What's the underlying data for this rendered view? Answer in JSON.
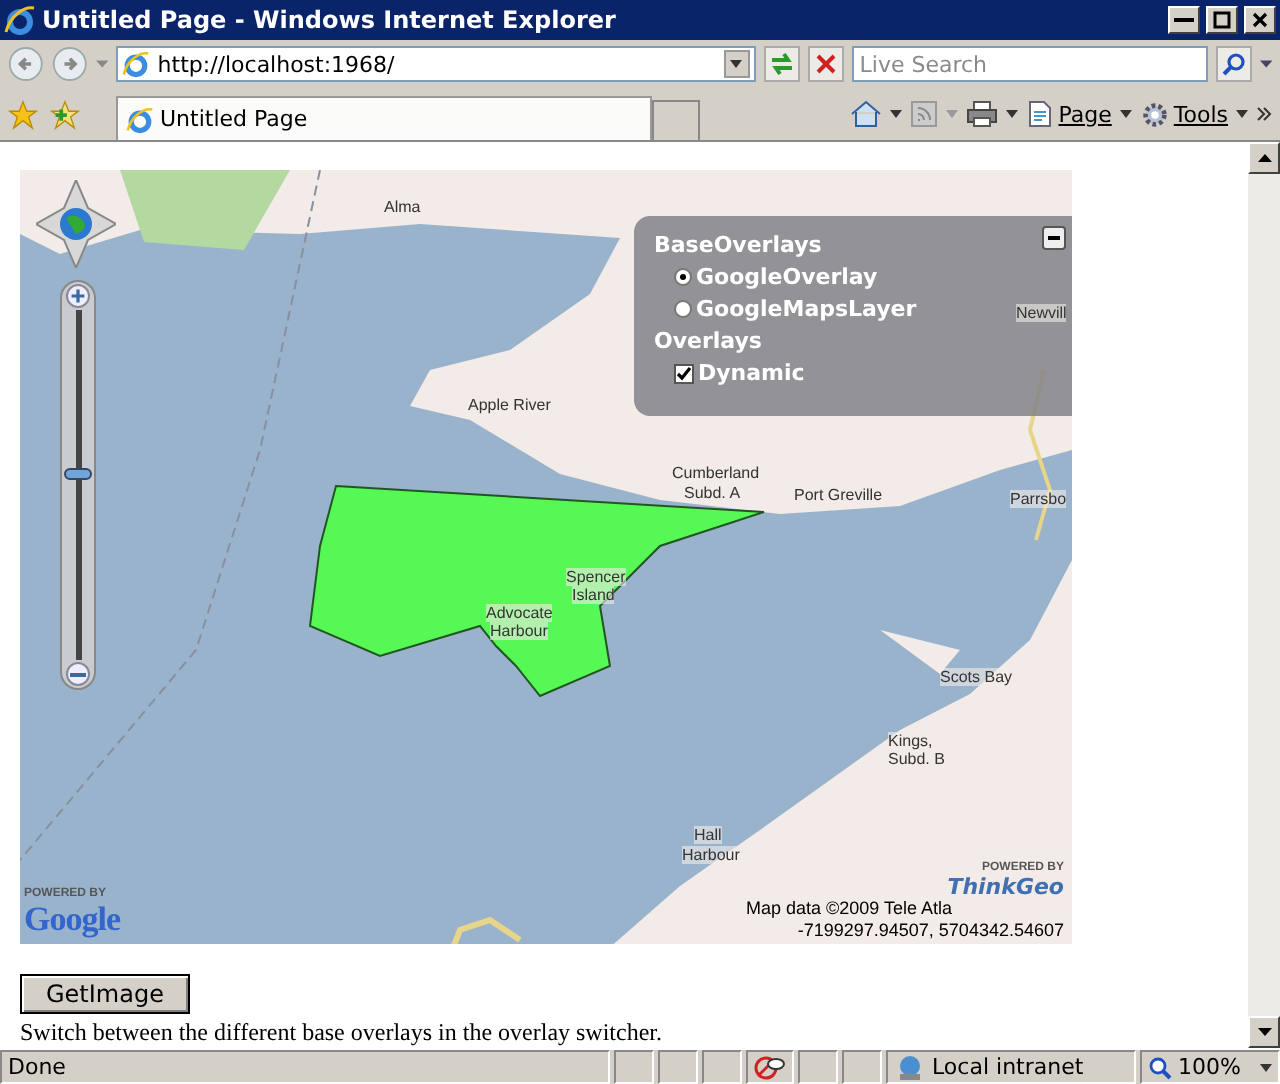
{
  "window": {
    "title": "Untitled Page - Windows Internet Explorer"
  },
  "address_bar": {
    "url": "http://localhost:1968/"
  },
  "search": {
    "placeholder": "Live Search"
  },
  "tab": {
    "title": "Untitled Page"
  },
  "command_bar": {
    "items": [
      "Page",
      "Tools"
    ]
  },
  "map": {
    "labels": [
      {
        "text": "Alma"
      },
      {
        "text": "Apple River"
      },
      {
        "text": "Cumberland"
      },
      {
        "text": "Subd. A"
      },
      {
        "text": "Port Greville"
      },
      {
        "text": "Parrsbo"
      },
      {
        "text": "Newvill"
      },
      {
        "text": "Spencer"
      },
      {
        "text": "Island"
      },
      {
        "text": "Advocate"
      },
      {
        "text": "Harbour"
      },
      {
        "text": "Scots Bay"
      },
      {
        "text": "Kings,"
      },
      {
        "text": "Subd. B"
      },
      {
        "text": "Hall"
      },
      {
        "text": "Harbour"
      }
    ],
    "zoom": {
      "level": 0.53
    },
    "layer_switcher": {
      "base_title": "BaseOverlays",
      "base_layers": [
        {
          "label": "GoogleOverlay",
          "selected": true
        },
        {
          "label": "GoogleMapsLayer",
          "selected": false
        }
      ],
      "overlay_title": "Overlays",
      "overlays": [
        {
          "label": "Dynamic",
          "checked": true
        }
      ]
    },
    "google_logo": {
      "powered_by": "POWERED BY",
      "name": "Google"
    },
    "thinkgeo_logo": {
      "powered_by": "POWERED BY",
      "name": "ThinkGeo"
    },
    "attribution": "Map data ©2009 Tele Atla",
    "coordinates": "-7199297.94507, 5704342.54607"
  },
  "button": "GetImage",
  "description": "Switch between the different base overlays in the overlay switcher.",
  "status_bar": {
    "status": "Done",
    "zone": "Local intranet",
    "zoom": "100%"
  }
}
